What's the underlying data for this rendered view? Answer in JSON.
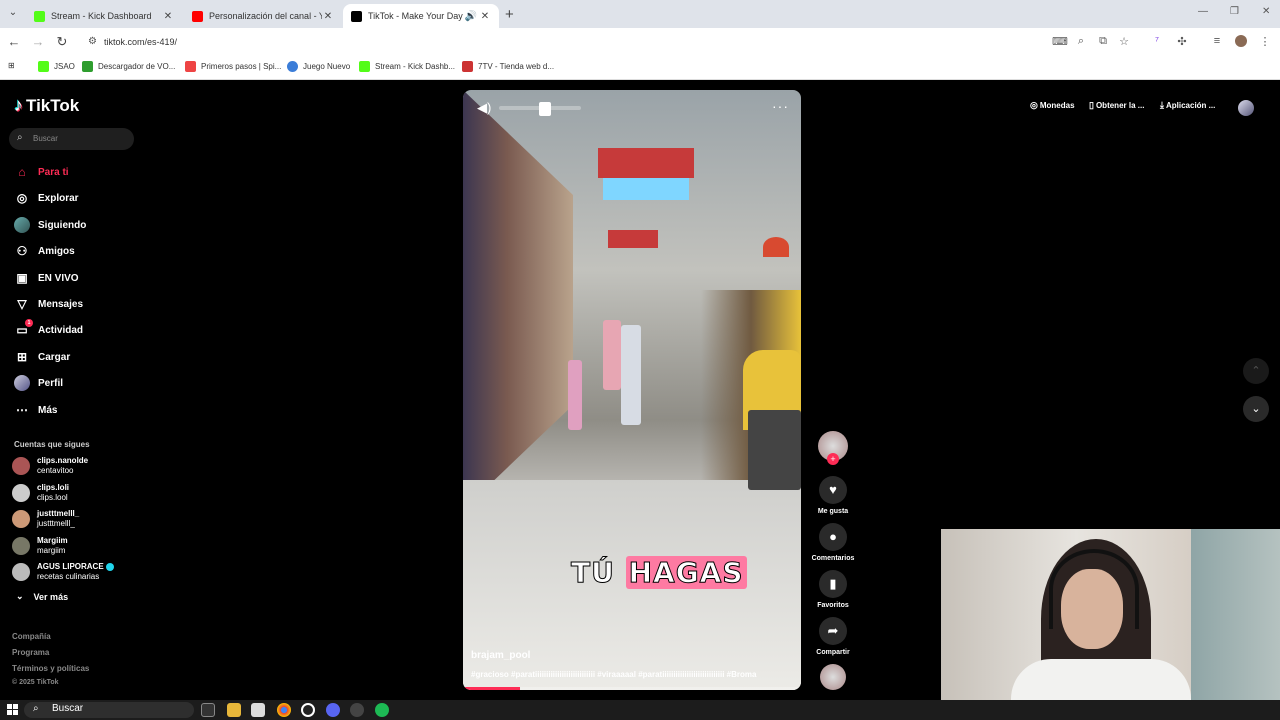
{
  "browser": {
    "tabs": [
      {
        "title": "Stream - Kick Dashboard",
        "favicon_color": "#53fc18",
        "active": false
      },
      {
        "title": "Personalización del canal - You",
        "favicon_color": "#ff0000",
        "active": false
      },
      {
        "title": "TikTok - Make Your Day",
        "favicon_color": "#000000",
        "active": true
      }
    ],
    "url": "tiktok.com/es-419/",
    "bookmarks": [
      {
        "label": "JSAO",
        "color": "#53fc18"
      },
      {
        "label": "Descargador de VO...",
        "color": "#2e9d2e"
      },
      {
        "label": "Primeros pasos | Spi...",
        "color": "#e44"
      },
      {
        "label": "Juego Nuevo",
        "color": "#3b7dd8"
      },
      {
        "label": "Stream - Kick Dashb...",
        "color": "#53fc18"
      },
      {
        "label": "7TV - Tienda web d...",
        "color": "#c33"
      }
    ]
  },
  "tiktok": {
    "logo": "TikTok",
    "search_placeholder": "Buscar",
    "nav": [
      {
        "label": "Para ti",
        "icon": "home-icon",
        "active": true
      },
      {
        "label": "Explorar",
        "icon": "compass-icon",
        "active": false
      },
      {
        "label": "Siguiendo",
        "icon": "following-avatar",
        "active": false
      },
      {
        "label": "Amigos",
        "icon": "friends-icon",
        "active": false
      },
      {
        "label": "EN VIVO",
        "icon": "live-icon",
        "active": false
      },
      {
        "label": "Mensajes",
        "icon": "messages-icon",
        "active": false
      },
      {
        "label": "Actividad",
        "icon": "activity-icon",
        "active": false,
        "badge": "1"
      },
      {
        "label": "Cargar",
        "icon": "upload-icon",
        "active": false
      },
      {
        "label": "Perfil",
        "icon": "profile-avatar",
        "active": false
      },
      {
        "label": "Más",
        "icon": "more-icon",
        "active": false
      }
    ],
    "following_title": "Cuentas que sigues",
    "following": [
      {
        "name": "clips.nanolde",
        "handle": "centavitoo",
        "verified": false,
        "color": "#a55"
      },
      {
        "name": "clips.loli",
        "handle": "clips.lool",
        "verified": false,
        "color": "#ccc"
      },
      {
        "name": "justttmelll_",
        "handle": "justttmelll_",
        "verified": false,
        "color": "#c97"
      },
      {
        "name": "Margiim",
        "handle": "margiim",
        "verified": false,
        "color": "#776"
      },
      {
        "name": "AGUS LIPORACE",
        "handle": "recetas culinarias",
        "verified": true,
        "color": "#bbb"
      }
    ],
    "see_more": "Ver más",
    "footer": [
      "Compañía",
      "Programa",
      "Términos y políticas",
      "© 2025 TikTok"
    ],
    "top_buttons": [
      {
        "label": "Monedas",
        "icon": "coin-icon"
      },
      {
        "label": "Obtener la ...",
        "icon": "phone-icon"
      },
      {
        "label": "Aplicación ...",
        "icon": "download-icon"
      }
    ],
    "video": {
      "subtitle_white": "TÚ",
      "subtitle_highlight": "HAGAS",
      "author": "brajam_pool",
      "caption": "#gracioso #paratiiiiiiiiiiiiiiiiiiiiiiiiiii #viraaaaal #paratiiiiiiiiiiiiiiiiiiiiiiiiiiii #Broma",
      "progress": 0.17
    },
    "actions": [
      {
        "label": "Me gusta",
        "icon": "heart-icon"
      },
      {
        "label": "Comentarios",
        "icon": "comment-icon"
      },
      {
        "label": "Favoritos",
        "icon": "bookmark-icon"
      },
      {
        "label": "Compartir",
        "icon": "share-icon"
      }
    ]
  },
  "taskbar": {
    "search_placeholder": "Buscar"
  }
}
